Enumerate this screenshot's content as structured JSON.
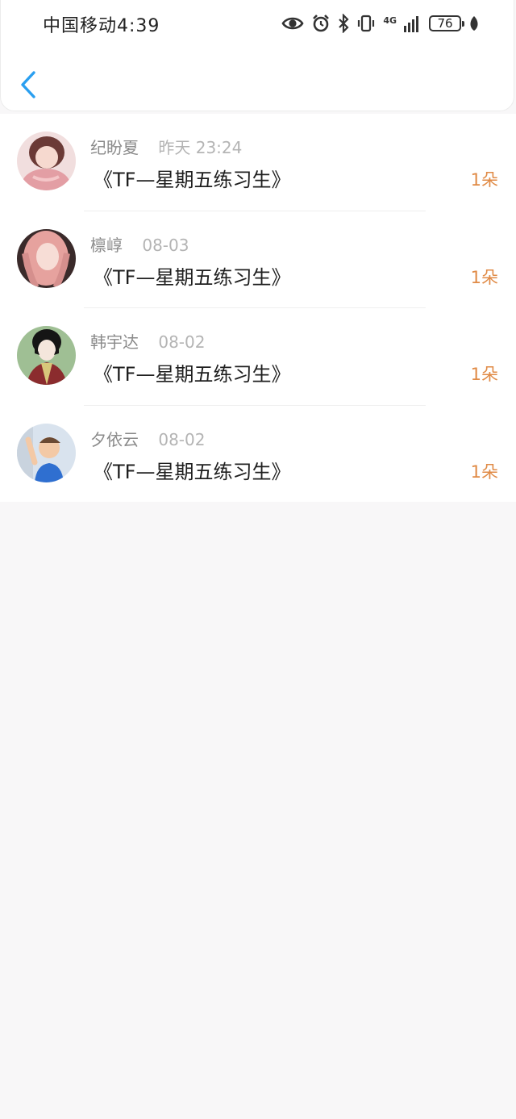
{
  "status_bar": {
    "carrier_time": "中国移动4:39",
    "icons": [
      "eye-icon",
      "alarm-icon",
      "bluetooth-icon",
      "vibrate-icon",
      "4g-signal-icon"
    ],
    "network": "4G",
    "battery": "76"
  },
  "nav": {
    "back_icon": "chevron-left-icon",
    "accent_color": "#2a9ff0"
  },
  "messages": [
    {
      "name": "纪盼夏",
      "time": "昨天 23:24",
      "title": "《TF—星期五练习生》",
      "count": "1朵"
    },
    {
      "name": "檩崞",
      "time": "08-03",
      "title": "《TF—星期五练习生》",
      "count": "1朵"
    },
    {
      "name": "韩宇达",
      "time": "08-02",
      "title": "《TF—星期五练习生》",
      "count": "1朵"
    },
    {
      "name": "夕依云",
      "time": "08-02",
      "title": "《TF—星期五练习生》",
      "count": "1朵"
    }
  ],
  "colors": {
    "count": "#e08a45",
    "name": "#8a8a8a",
    "time": "#b4b4b4",
    "background": "#f8f7f8"
  }
}
